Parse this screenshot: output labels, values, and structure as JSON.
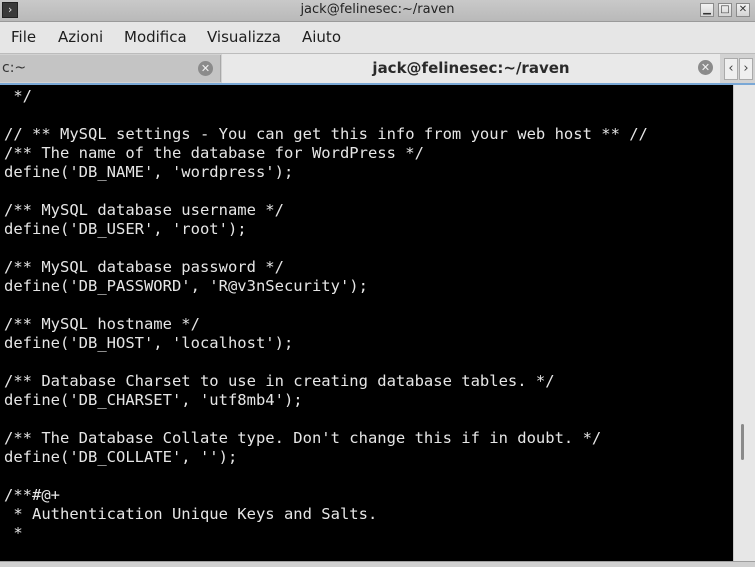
{
  "window": {
    "title": "jack@felinesec:~/raven",
    "app_icon": "terminal-icon",
    "controls": {
      "minimize": "minimize-icon",
      "maximize": "maximize-icon",
      "close": "close-icon"
    }
  },
  "menu": {
    "items": [
      "File",
      "Azioni",
      "Modifica",
      "Visualizza",
      "Aiuto"
    ]
  },
  "tabs": [
    {
      "label": "c:~",
      "active": false
    },
    {
      "label": "jack@felinesec:~/raven",
      "active": true
    }
  ],
  "tab_nav": {
    "prev": "‹",
    "next": "›"
  },
  "terminal": {
    "lines": [
      " */",
      "",
      "// ** MySQL settings - You can get this info from your web host ** //",
      "/** The name of the database for WordPress */",
      "define('DB_NAME', 'wordpress');",
      "",
      "/** MySQL database username */",
      "define('DB_USER', 'root');",
      "",
      "/** MySQL database password */",
      "define('DB_PASSWORD', 'R@v3nSecurity');",
      "",
      "/** MySQL hostname */",
      "define('DB_HOST', 'localhost');",
      "",
      "/** Database Charset to use in creating database tables. */",
      "define('DB_CHARSET', 'utf8mb4');",
      "",
      "/** The Database Collate type. Don't change this if in doubt. */",
      "define('DB_COLLATE', '');",
      "",
      "/**#@+",
      " * Authentication Unique Keys and Salts.",
      " *"
    ],
    "scroll_position": 0.71
  },
  "colors": {
    "terminal_bg": "#000000",
    "terminal_fg": "#e6e6e6",
    "focus_accent": "#7aa8d6"
  }
}
